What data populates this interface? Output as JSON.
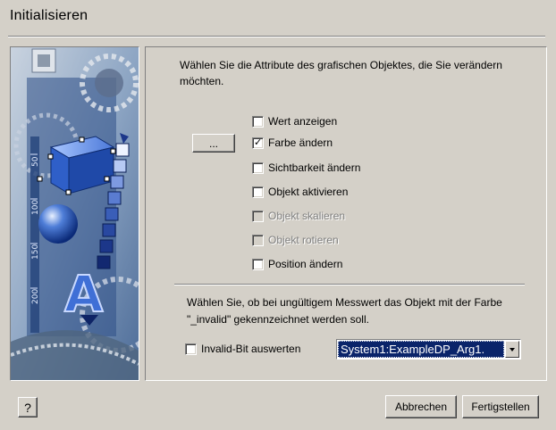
{
  "dialog": {
    "title": "Initialisieren"
  },
  "attributes": {
    "intro": "Wählen Sie die Attribute des grafischen Objektes, die Sie verändern möchten.",
    "browse_label": "...",
    "items": [
      {
        "label": "Wert anzeigen",
        "checked": false,
        "enabled": true
      },
      {
        "label": "Farbe ändern",
        "checked": true,
        "enabled": true
      },
      {
        "label": "Sichtbarkeit ändern",
        "checked": false,
        "enabled": true
      },
      {
        "label": "Objekt aktivieren",
        "checked": false,
        "enabled": true
      },
      {
        "label": "Objekt skalieren",
        "checked": false,
        "enabled": false
      },
      {
        "label": "Objekt rotieren",
        "checked": false,
        "enabled": false
      },
      {
        "label": "Position ändern",
        "checked": false,
        "enabled": true
      }
    ]
  },
  "invalid": {
    "text": "Wählen Sie, ob bei ungültigem Messwert das Objekt mit der Farbe \"_invalid\" gekennzeichnet werden soll.",
    "checkbox_label": "Invalid-Bit auswerten",
    "checked": false,
    "datapoint_value": "System1:ExampleDP_Arg1."
  },
  "illustration": {
    "ruler_labels": [
      "50",
      "100",
      "150",
      "200"
    ],
    "letter": "A"
  },
  "footer": {
    "help_label": "?",
    "cancel_label": "Abbrechen",
    "finish_label": "Fertigstellen"
  },
  "colors": {
    "dialog_bg": "#d4d0c8",
    "selection": "#0a246a"
  }
}
